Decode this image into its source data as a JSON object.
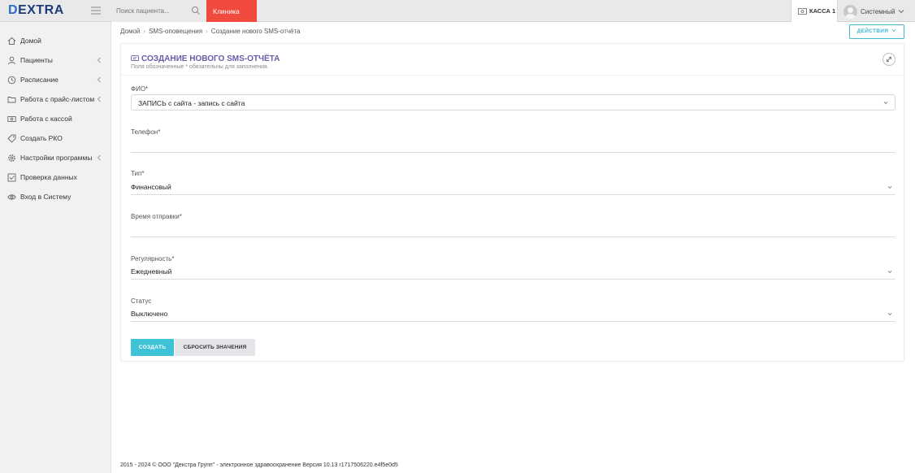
{
  "header": {
    "logo_mark": "D",
    "logo_text": "EXTRA",
    "search_placeholder": "Поиск пациента...",
    "clinic_label": "Клиника",
    "kassa_label": "КАССА 1",
    "user_name": "Системный"
  },
  "sidebar": {
    "items": [
      {
        "label": "Домой",
        "icon": "home-icon",
        "has_chevron": false
      },
      {
        "label": "Пациенты",
        "icon": "user-icon",
        "has_chevron": true
      },
      {
        "label": "Расписание",
        "icon": "clock-icon",
        "has_chevron": true
      },
      {
        "label": "Работа с прайс-листом",
        "icon": "folder-icon",
        "has_chevron": true
      },
      {
        "label": "Работа с кассой",
        "icon": "cash-icon",
        "has_chevron": false
      },
      {
        "label": "Создать РКО",
        "icon": "tag-icon",
        "has_chevron": false
      },
      {
        "label": "Настройки программы",
        "icon": "gear-icon",
        "has_chevron": true
      },
      {
        "label": "Проверка данных",
        "icon": "checkbox-icon",
        "has_chevron": false
      },
      {
        "label": "Вход в Систему",
        "icon": "eye-icon",
        "has_chevron": false
      }
    ]
  },
  "breadcrumb": [
    "Домой",
    "SMS-оповещения",
    "Создание нового SMS-отчёта"
  ],
  "actions_label": "ДЕЙСТВИЯ",
  "form": {
    "title": "СОЗДАНИЕ НОВОГО SMS-ОТЧЁТА",
    "subtitle": "Поля обозначенные * обязательны для заполнения.",
    "fio_label": "ФИО*",
    "fio_value": "ЗАПИСЬ с сайта - запись с сайта",
    "phone_label": "Телефон*",
    "phone_value": "",
    "type_label": "Тип*",
    "type_value": "Финансовый",
    "send_time_label": "Время отправки*",
    "send_time_value": "",
    "regularity_label": "Регулярность*",
    "regularity_value": "Ежедневный",
    "status_label": "Статус",
    "status_value": "Выключено",
    "create_button": "СОЗДАТЬ",
    "reset_button": "СБРОСИТЬ ЗНАЧЕНИЯ"
  },
  "footer": "2015 - 2024 © ООО \"Декстра Групп\" - электронное здравоохранение Версия 10.13 r1717506220.e4f5e0d5",
  "colors": {
    "accent": "#3ec2d6",
    "clinic": "#f04a3e",
    "title": "#6a5aa8"
  }
}
